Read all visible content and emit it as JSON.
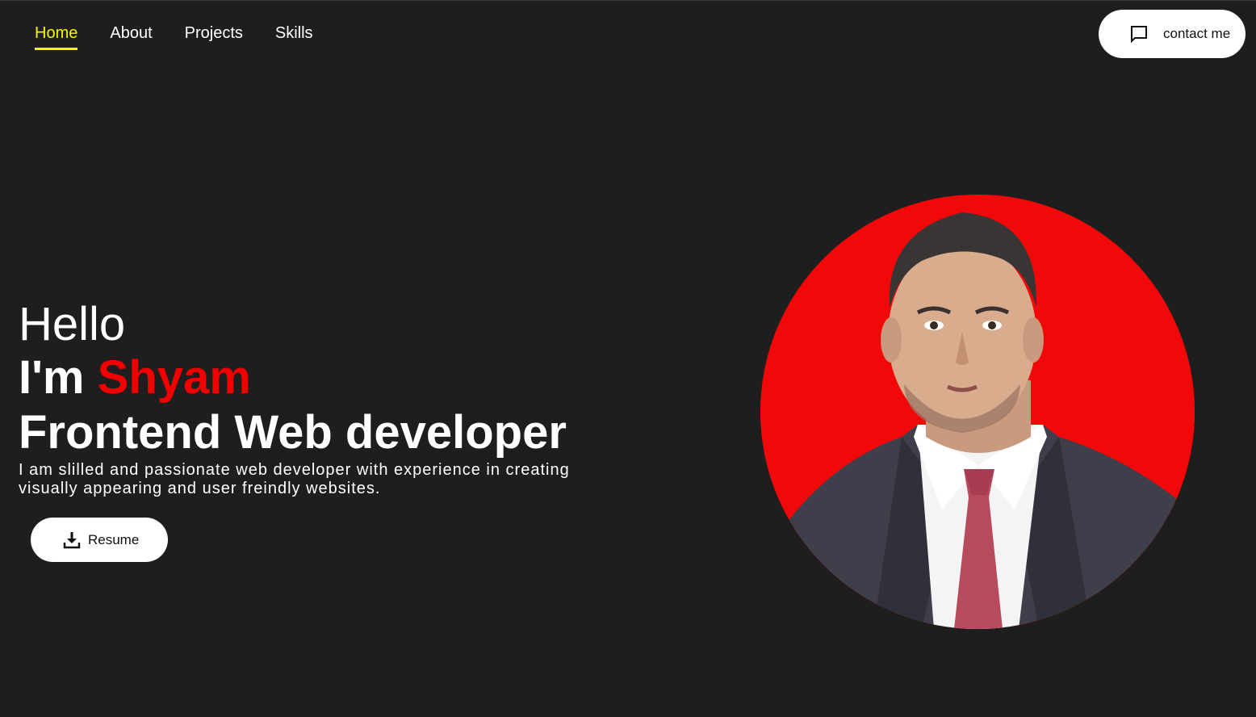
{
  "nav": {
    "items": [
      {
        "label": "Home",
        "active": true
      },
      {
        "label": "About",
        "active": false
      },
      {
        "label": "Projects",
        "active": false
      },
      {
        "label": "Skills",
        "active": false
      }
    ]
  },
  "contact": {
    "label": "contact me",
    "icon": "chat-bubble-icon"
  },
  "hero": {
    "greeting": "Hello",
    "intro_prefix": "I'm",
    "name": "Shyam",
    "role": "Frontend Web developer",
    "description": "I am slilled and passionate web developer with experience in creating visually appearing and user freindly websites."
  },
  "resume": {
    "label": "Resume",
    "icon": "download-icon"
  },
  "colors": {
    "background": "#1e1e1e",
    "accent_nav": "#f5f500",
    "accent_name": "#f20000",
    "portrait_bg": "#f20808"
  }
}
